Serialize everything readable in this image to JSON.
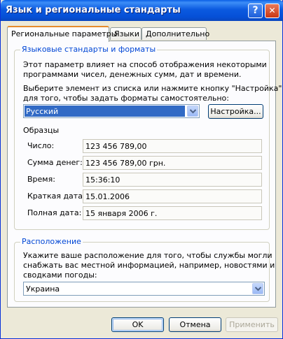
{
  "window": {
    "title": "Язык и региональные стандарты",
    "help": "?",
    "close": "✕"
  },
  "tabs": [
    "Региональные параметры",
    "Языки",
    "Дополнительно"
  ],
  "formats": {
    "title": "Языковые стандарты и форматы",
    "desc_line1": "Этот параметр влияет на способ отображения некоторыми",
    "desc_line2": "программами чисел, денежных сумм, дат и времени.",
    "select_line1": "Выберите элемент из списка или нажмите кнопку \"Настройка\"",
    "select_line2": "для того, чтобы задать форматы самостоятельно:",
    "selected_locale": "Русский",
    "customize_button": "Настройка...",
    "samples_title": "Образцы",
    "samples": [
      {
        "label": "Число:",
        "value": "123 456 789,00"
      },
      {
        "label": "Сумма денег:",
        "value": "123 456 789,00 грн."
      },
      {
        "label": "Время:",
        "value": "15:36:10"
      },
      {
        "label": "Краткая дата:",
        "value": "15.01.2006"
      },
      {
        "label": "Полная дата:",
        "value": "15 января 2006 г."
      }
    ]
  },
  "location": {
    "title": "Расположение",
    "desc_line1": "Укажите ваше расположение для того, чтобы службы могли",
    "desc_line2": "снабжать вас местной информацией, например, новостями и",
    "desc_line3": "сводками погоды:",
    "selected_location": "Украина"
  },
  "buttons": {
    "ok": "OK",
    "cancel": "Отмена",
    "apply": "Применить"
  }
}
